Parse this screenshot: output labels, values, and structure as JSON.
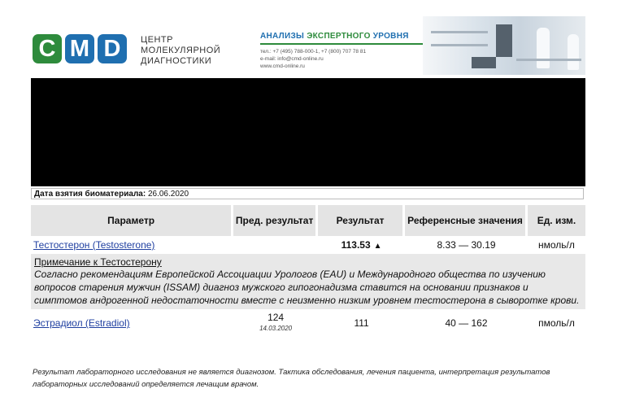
{
  "header": {
    "logo_letters": [
      "C",
      "M",
      "D"
    ],
    "center_name": [
      "ЦЕНТР",
      "МОЛЕКУЛЯРНОЙ",
      "ДИАГНОСТИКИ"
    ],
    "slogan_part1": "АНАЛИЗЫ ",
    "slogan_part2": "ЭКСПЕРТНОГО",
    "slogan_part3": " УРОВНЯ",
    "contacts": [
      "тел.: +7 (495) 788-000-1, +7 (800) 707 78 81",
      "e-mail: info@cmd-online.ru",
      "www.cmd-online.ru"
    ],
    "brand_colors": {
      "green": "#2e8b3c",
      "blue": "#1f6fb0"
    }
  },
  "date_line": {
    "label": "Дата взятия биоматериала:",
    "value": "26.06.2020"
  },
  "table": {
    "headers": {
      "param": "Параметр",
      "prev": "Пред. результат",
      "result": "Результат",
      "ref": "Референсные значения",
      "unit": "Ед. изм."
    },
    "rows": [
      {
        "param": "Тестостерон (Testosterone)",
        "prev": "",
        "prev_date": "",
        "result": "113.53",
        "result_flag_icon": "up-triangle-icon",
        "result_flag": "▲",
        "ref": "8.33 — 30.19",
        "unit": "нмоль/л"
      },
      {
        "param": "Эстрадиол (Estradiol)",
        "prev": "124",
        "prev_date": "14.03.2020",
        "result": "111",
        "ref": "40 — 162",
        "unit": "пмоль/л"
      }
    ],
    "note": {
      "title": "Примечание к Тестостерону",
      "text": "Согласно рекомендациям Европейской Ассоциации Урологов (EAU) и Международного общества по изучению вопросов старения мужчин (ISSAM) диагноз мужского гипогонадизма ставится на основании признаков и симптомов андрогенной недостаточности вместе с неизменно низким уровнем тестостерона в сыворотке крови."
    }
  },
  "footer": {
    "note": "Результат лабораторного исследования не является диагнозом. Тактика обследования, лечения пациента, интерпретация результатов лабораторных исследований определяется лечащим врачом."
  }
}
